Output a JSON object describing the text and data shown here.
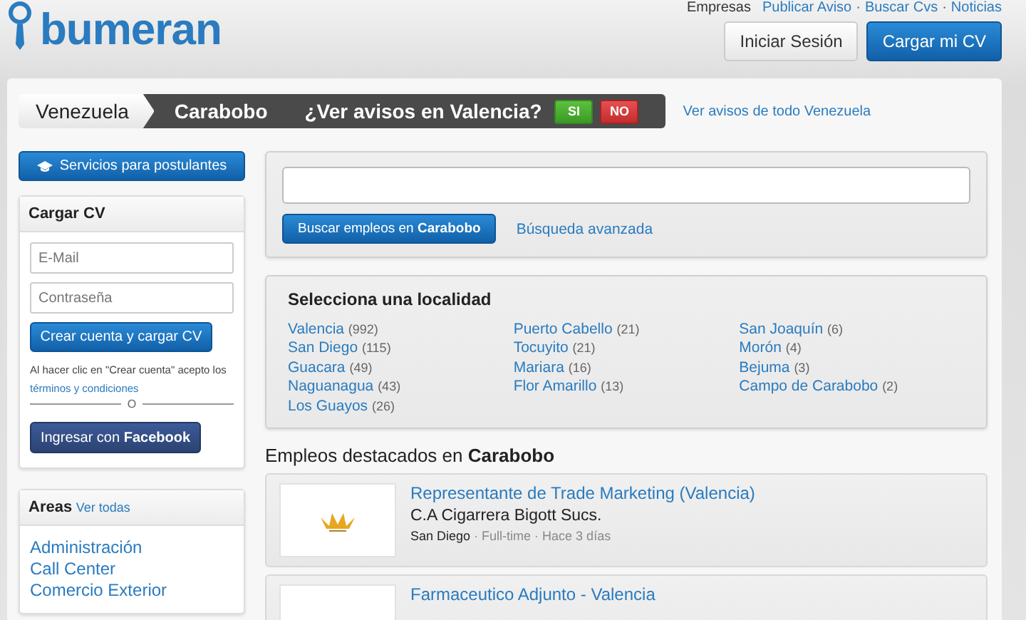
{
  "header": {
    "logo": "bumeran",
    "top_links": [
      {
        "label": "Empresas",
        "kind": "plain"
      },
      {
        "label": "Publicar Aviso",
        "kind": "link"
      },
      {
        "label": "·",
        "kind": "separator"
      },
      {
        "label": "Buscar Cvs",
        "kind": "link"
      },
      {
        "label": "·",
        "kind": "separator"
      },
      {
        "label": "Noticias",
        "kind": "link"
      }
    ],
    "login_button": "Iniciar Sesión",
    "upload_button": "Cargar mi CV"
  },
  "location_bar": {
    "country": "Venezuela",
    "region": "Carabobo",
    "question": "¿Ver avisos en Valencia?",
    "yes": "SI",
    "no": "NO",
    "all_link": "Ver avisos de todo Venezuela"
  },
  "sidebar": {
    "services_button": "Servicios para postulantes",
    "cv_card": {
      "title": "Cargar CV",
      "email_placeholder": "E-Mail",
      "password_placeholder": "Contraseña",
      "create_button": "Crear cuenta y cargar CV",
      "terms_text": "Al hacer clic en \"Crear cuenta\" acepto los",
      "terms_link": "términos y condiciones",
      "divider": "O",
      "facebook_button": "Ingresar con **Facebook**"
    },
    "areas_card": {
      "title": "Areas",
      "see_all": "Ver todas",
      "items": [
        "Administración",
        "Call Center",
        "Comercio Exterior"
      ]
    }
  },
  "search": {
    "button": "Buscar empleos en **Carabobo**",
    "advanced_link": "Búsqueda avanzada"
  },
  "localities": {
    "title": "Selecciona una localidad",
    "columns": [
      [
        {
          "name": "Valencia",
          "count": "(992)"
        },
        {
          "name": "San Diego",
          "count": "(115)"
        },
        {
          "name": "Guacara",
          "count": "(49)"
        },
        {
          "name": "Naguanagua",
          "count": "(43)"
        },
        {
          "name": "Los Guayos",
          "count": "(26)"
        }
      ],
      [
        {
          "name": "Puerto Cabello",
          "count": "(21)"
        },
        {
          "name": "Tocuyito",
          "count": "(21)"
        },
        {
          "name": "Mariara",
          "count": "(16)"
        },
        {
          "name": "Flor Amarillo",
          "count": "(13)"
        }
      ],
      [
        {
          "name": "San Joaquín",
          "count": "(6)"
        },
        {
          "name": "Morón",
          "count": "(4)"
        },
        {
          "name": "Bejuma",
          "count": "(3)"
        },
        {
          "name": "Campo de Carabobo",
          "count": "(2)"
        }
      ]
    ]
  },
  "featured": {
    "heading": "Empleos destacados en **Carabobo**",
    "jobs": [
      {
        "title": "Representante de Trade Marketing (Valencia)",
        "company": "C.A Cigarrera Bigott Sucs.",
        "location": "San Diego",
        "details": "· Full-time · Hace 3 días"
      },
      {
        "title": "Farmaceutico Adjunto - Valencia"
      }
    ]
  }
}
